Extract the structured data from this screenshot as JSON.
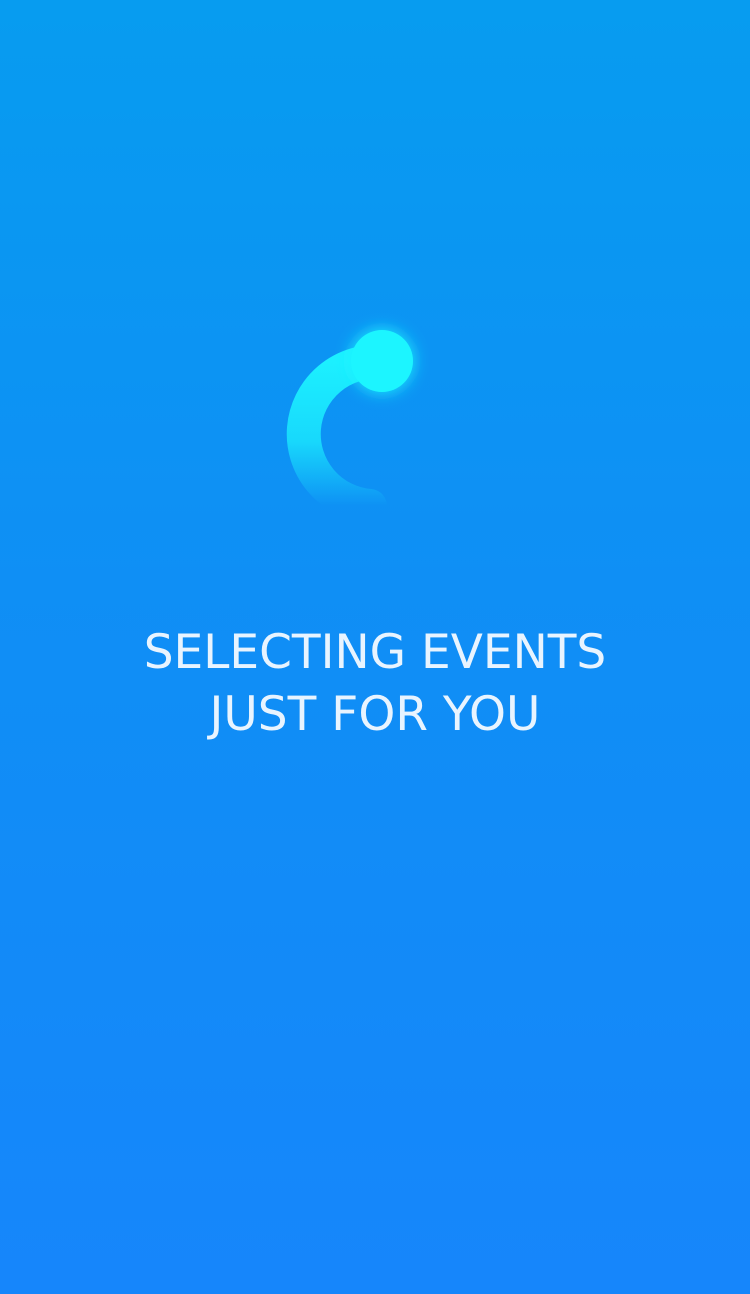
{
  "loading_screen": {
    "message_lines": [
      "SELECTING EVENTS",
      "JUST FOR YOU"
    ],
    "colors": {
      "background_top": "#079cf0",
      "background_bottom": "#1686fb",
      "spinner": "#1cf0ff",
      "text": "#e8f4ff"
    },
    "spinner_icon": "loading-spinner-icon"
  }
}
